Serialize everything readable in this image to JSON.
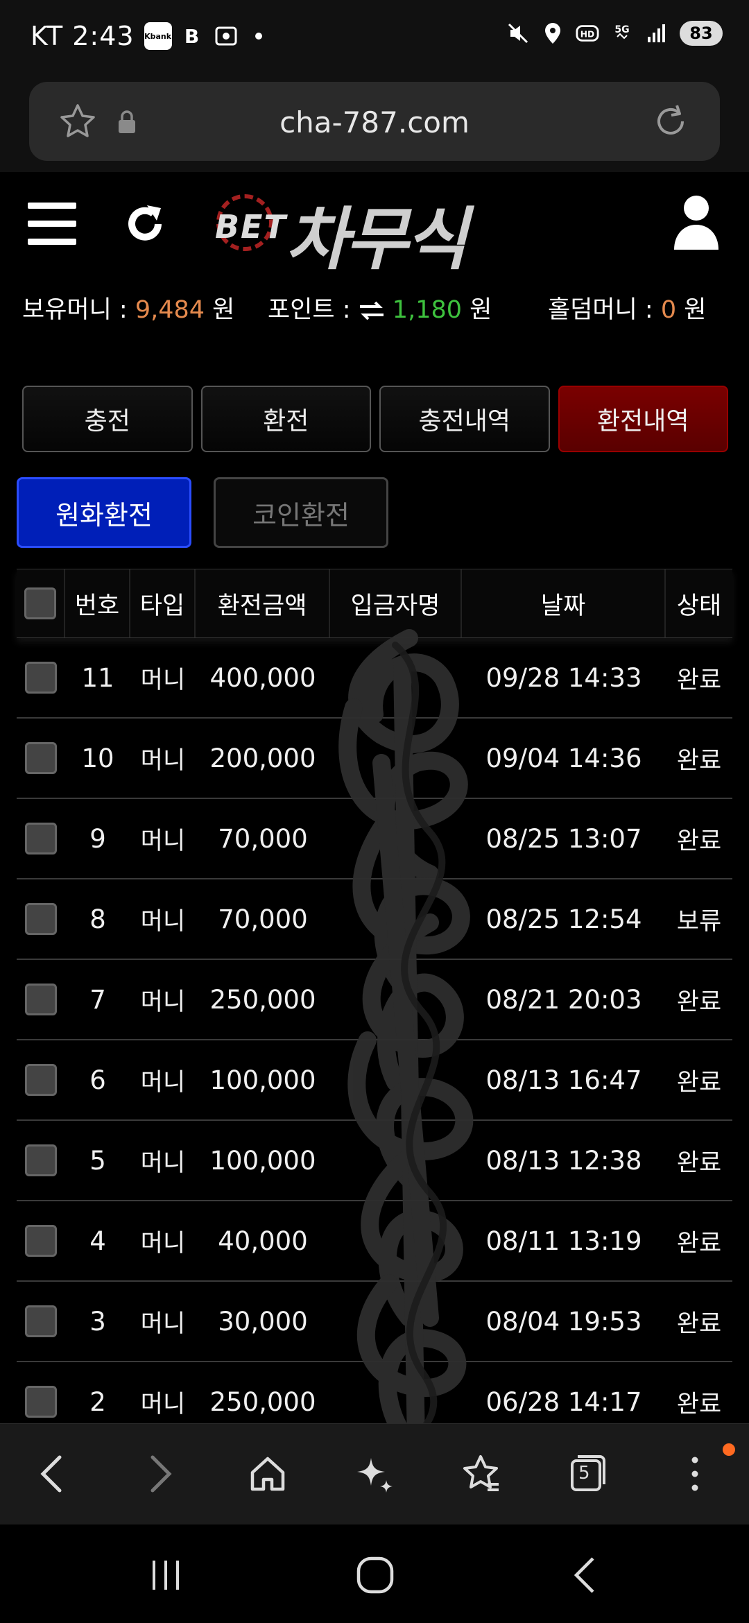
{
  "status_bar": {
    "carrier_time": "KT 2:43",
    "app_icons": [
      "Kbank",
      "B"
    ],
    "battery": "83"
  },
  "browser": {
    "url": "cha-787.com"
  },
  "site": {
    "logo_small": "BET",
    "logo_main": "차무식"
  },
  "balances": {
    "money_label": "보유머니 : ",
    "money_value": "9,484",
    "money_unit": " 원",
    "point_label": "포인트 : ",
    "point_value": "1,180",
    "point_unit": " 원",
    "hold_label": "홀덤머니 : ",
    "hold_value": "0",
    "hold_unit": " 원"
  },
  "tabs": [
    {
      "label": "충전",
      "active": false
    },
    {
      "label": "환전",
      "active": false
    },
    {
      "label": "충전내역",
      "active": false
    },
    {
      "label": "환전내역",
      "active": true
    }
  ],
  "subtabs": [
    {
      "label": "원화환전",
      "active": true
    },
    {
      "label": "코인환전",
      "active": false
    }
  ],
  "table": {
    "headers": {
      "no": "번호",
      "type": "타입",
      "amount": "환전금액",
      "depositor": "입금자명",
      "date": "날짜",
      "status": "상태"
    },
    "rows": [
      {
        "no": "11",
        "type": "머니",
        "amount": "400,000",
        "date": "09/28 14:33",
        "status": "완료"
      },
      {
        "no": "10",
        "type": "머니",
        "amount": "200,000",
        "date": "09/04 14:36",
        "status": "완료"
      },
      {
        "no": "9",
        "type": "머니",
        "amount": "70,000",
        "date": "08/25 13:07",
        "status": "완료"
      },
      {
        "no": "8",
        "type": "머니",
        "amount": "70,000",
        "date": "08/25 12:54",
        "status": "보류"
      },
      {
        "no": "7",
        "type": "머니",
        "amount": "250,000",
        "date": "08/21 20:03",
        "status": "완료"
      },
      {
        "no": "6",
        "type": "머니",
        "amount": "100,000",
        "date": "08/13 16:47",
        "status": "완료"
      },
      {
        "no": "5",
        "type": "머니",
        "amount": "100,000",
        "date": "08/13 12:38",
        "status": "완료"
      },
      {
        "no": "4",
        "type": "머니",
        "amount": "40,000",
        "date": "08/11 13:19",
        "status": "완료"
      },
      {
        "no": "3",
        "type": "머니",
        "amount": "30,000",
        "date": "08/04 19:53",
        "status": "완료"
      },
      {
        "no": "2",
        "type": "머니",
        "amount": "250,000",
        "date": "06/28 14:17",
        "status": "완료"
      }
    ]
  },
  "browser_nav": {
    "tab_count": "5"
  },
  "colors": {
    "accent_red": "#7a0000",
    "accent_blue": "#001fb8",
    "money_orange": "#e58a4e",
    "point_green": "#3ec23e",
    "notif_orange": "#ff6a21"
  }
}
